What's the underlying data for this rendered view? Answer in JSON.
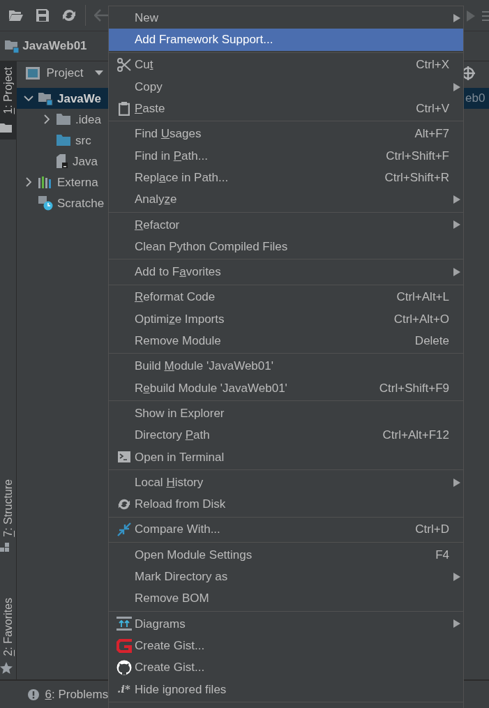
{
  "nav_bar": {
    "project": "JavaWeb01"
  },
  "side_stripe": {
    "tabs": [
      {
        "key": "1",
        "after": ": Project",
        "selected": true
      },
      {
        "key": "7",
        "after": ": Structure",
        "selected": false
      },
      {
        "key": "2",
        "after": ": Favorites",
        "selected": false
      }
    ]
  },
  "project_panel": {
    "title": "Project",
    "tree": [
      {
        "label": "JavaWe",
        "bold": true,
        "selected": true,
        "expanded": true,
        "side_text": "eb0",
        "children": [
          {
            "label": ".idea",
            "expanded": false
          },
          {
            "label": "src"
          },
          {
            "label": "Java"
          }
        ]
      },
      {
        "label": "Externa",
        "bold": false,
        "selected": false,
        "expanded": false
      },
      {
        "label": "Scratche",
        "bold": false,
        "selected": false
      }
    ]
  },
  "context_menu": {
    "groups": [
      [
        {
          "label": {
            "before": "New"
          },
          "has_submenu": true,
          "selected": false
        },
        {
          "label": {
            "before": "Add Framework Support..."
          },
          "has_submenu": false,
          "selected": true
        }
      ],
      [
        {
          "label": {
            "before": "Cu",
            "key": "t"
          },
          "shortcut": "Ctrl+X",
          "has_submenu": false,
          "selected": false
        },
        {
          "label": {
            "before": "Copy"
          },
          "has_submenu": true,
          "selected": false
        },
        {
          "label": {
            "key": "P",
            "after": "aste"
          },
          "shortcut": "Ctrl+V",
          "has_submenu": false,
          "selected": false
        }
      ],
      [
        {
          "label": {
            "before": "Find ",
            "key": "U",
            "after": "sages"
          },
          "shortcut": "Alt+F7",
          "has_submenu": false,
          "selected": false
        },
        {
          "label": {
            "before": "Find in ",
            "key": "P",
            "after": "ath..."
          },
          "shortcut": "Ctrl+Shift+F",
          "has_submenu": false,
          "selected": false
        },
        {
          "label": {
            "before": "Repl",
            "key": "a",
            "after": "ce in Path..."
          },
          "shortcut": "Ctrl+Shift+R",
          "has_submenu": false,
          "selected": false
        },
        {
          "label": {
            "before": "Analy",
            "key": "z",
            "after": "e"
          },
          "has_submenu": true,
          "selected": false
        }
      ],
      [
        {
          "label": {
            "key": "R",
            "after": "efactor"
          },
          "has_submenu": true,
          "selected": false
        },
        {
          "label": {
            "before": "Clean Python Compiled Files"
          },
          "has_submenu": false,
          "selected": false
        }
      ],
      [
        {
          "label": {
            "before": "Add to F",
            "key": "a",
            "after": "vorites"
          },
          "has_submenu": true,
          "selected": false
        }
      ],
      [
        {
          "label": {
            "key": "R",
            "after": "eformat Code"
          },
          "shortcut": "Ctrl+Alt+L",
          "has_submenu": false,
          "selected": false
        },
        {
          "label": {
            "before": "Optimi",
            "key": "z",
            "after": "e Imports"
          },
          "shortcut": "Ctrl+Alt+O",
          "has_submenu": false,
          "selected": false
        },
        {
          "label": {
            "before": "Remove Module"
          },
          "shortcut": "Delete",
          "has_submenu": false,
          "selected": false
        }
      ],
      [
        {
          "label": {
            "before": "Build ",
            "key": "M",
            "after": "odule 'JavaWeb01'"
          },
          "has_submenu": false,
          "selected": false
        },
        {
          "label": {
            "before": "R",
            "key": "e",
            "after": "build Module 'JavaWeb01'"
          },
          "shortcut": "Ctrl+Shift+F9",
          "has_submenu": false,
          "selected": false
        }
      ],
      [
        {
          "label": {
            "before": "Show in Explorer"
          },
          "has_submenu": false,
          "selected": false
        },
        {
          "label": {
            "before": "Directory ",
            "key": "P",
            "after": "ath"
          },
          "shortcut": "Ctrl+Alt+F12",
          "has_submenu": false,
          "selected": false
        },
        {
          "label": {
            "before": "Open in Terminal"
          },
          "has_submenu": false,
          "selected": false
        }
      ],
      [
        {
          "label": {
            "before": "Local ",
            "key": "H",
            "after": "istory"
          },
          "has_submenu": true,
          "selected": false
        },
        {
          "label": {
            "before": "Reload from Disk"
          },
          "has_submenu": false,
          "selected": false
        }
      ],
      [
        {
          "label": {
            "before": "Compare With..."
          },
          "shortcut": "Ctrl+D",
          "has_submenu": false,
          "selected": false
        }
      ],
      [
        {
          "label": {
            "before": "Open Module Settings"
          },
          "shortcut": "F4",
          "has_submenu": false,
          "selected": false
        },
        {
          "label": {
            "before": "Mark Directory as"
          },
          "has_submenu": true,
          "selected": false
        },
        {
          "label": {
            "before": "Remove BOM"
          },
          "has_submenu": false,
          "selected": false
        }
      ],
      [
        {
          "label": {
            "before": "Diagrams"
          },
          "has_submenu": true,
          "selected": false
        },
        {
          "label": {
            "before": "Create Gist..."
          },
          "has_submenu": false,
          "selected": false
        },
        {
          "label": {
            "before": "Create Gist..."
          },
          "has_submenu": false,
          "selected": false
        },
        {
          "label": {
            "before": "Hide ignored files"
          },
          "icon_text": ".i*",
          "has_submenu": false,
          "selected": false
        }
      ]
    ]
  },
  "status_bar": {
    "tool": {
      "key": "6",
      "after": ": Problems"
    }
  }
}
